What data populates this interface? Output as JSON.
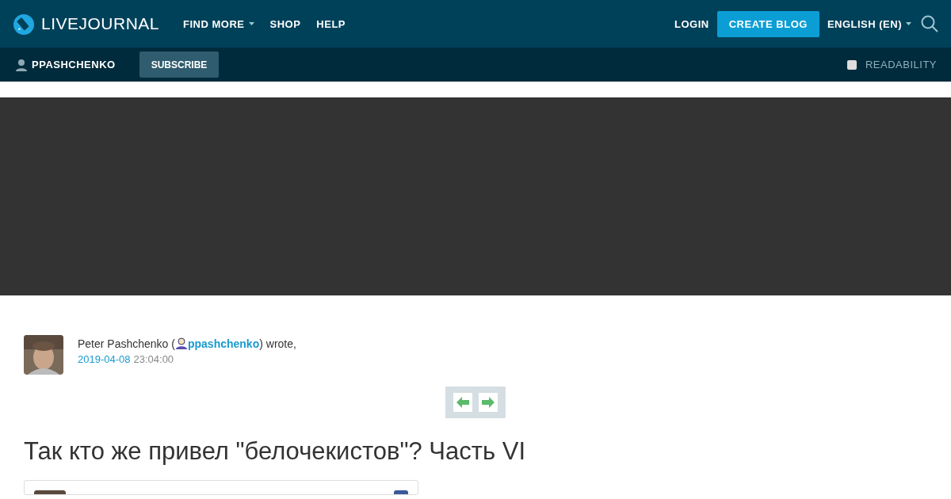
{
  "header": {
    "logo": "LIVEJOURNAL",
    "nav": [
      {
        "label": "FIND MORE",
        "dropdown": true
      },
      {
        "label": "SHOP",
        "dropdown": false
      },
      {
        "label": "HELP",
        "dropdown": false
      }
    ],
    "login": "LOGIN",
    "create": "CREATE BLOG",
    "language": "ENGLISH (EN)"
  },
  "subbar": {
    "user": "PPASHCHENKO",
    "subscribe": "SUBSCRIBE",
    "readability": {
      "label": "READABILITY",
      "checked": false
    }
  },
  "post": {
    "author_before": "Peter Pashchenko (",
    "author_link": "ppashchenko",
    "author_after": ") wrote,",
    "date": "2019-04-08",
    "time": "23:04:00",
    "title": "Так кто же привел \"белочекистов\"? Часть VI"
  }
}
